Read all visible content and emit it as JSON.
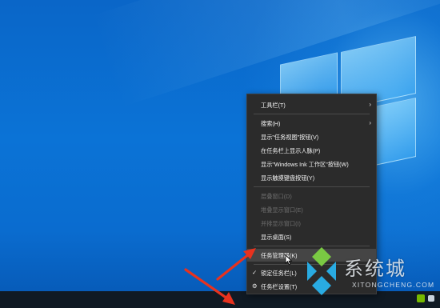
{
  "context_menu": {
    "items": [
      {
        "label": "工具栏(T)",
        "submenu": true,
        "disabled": false
      },
      {
        "label": "搜索(H)",
        "submenu": true,
        "disabled": false
      },
      {
        "label": "显示\"任务视图\"按钮(V)",
        "submenu": false,
        "disabled": false
      },
      {
        "label": "在任务栏上显示人脉(P)",
        "submenu": false,
        "disabled": false
      },
      {
        "label": "显示\"Windows Ink 工作区\"按钮(W)",
        "submenu": false,
        "disabled": false
      },
      {
        "label": "显示触摸键盘按钮(Y)",
        "submenu": false,
        "disabled": false
      },
      {
        "label": "层叠窗口(D)",
        "submenu": false,
        "disabled": true
      },
      {
        "label": "堆叠显示窗口(E)",
        "submenu": false,
        "disabled": true
      },
      {
        "label": "并排显示窗口(I)",
        "submenu": false,
        "disabled": true
      },
      {
        "label": "显示桌面(S)",
        "submenu": false,
        "disabled": false
      },
      {
        "label": "任务管理器(K)",
        "submenu": false,
        "disabled": false,
        "highlighted": true
      },
      {
        "label": "锁定任务栏(L)",
        "submenu": false,
        "disabled": false,
        "checked": true
      },
      {
        "label": "任务栏设置(T)",
        "submenu": false,
        "disabled": false,
        "icon": "gear-icon"
      }
    ]
  },
  "watermark": {
    "cn_text": "系统城",
    "en_text": "XITONGCHENG.COM"
  },
  "colors": {
    "menu_bg": "#2b2b2b",
    "menu_hover": "#454545",
    "arrow_red": "#e8321e",
    "taskbar": "#101a24"
  }
}
